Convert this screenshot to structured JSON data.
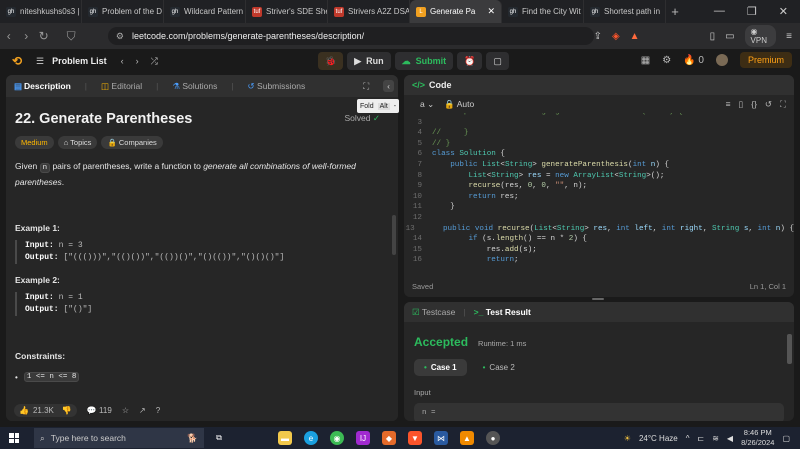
{
  "browser": {
    "tabs": [
      {
        "label": "niteshkushs0s3 |",
        "fav_color": "#24292f",
        "fav_text": "gh"
      },
      {
        "label": "Problem of the D",
        "fav_color": "#24292f",
        "fav_text": "gh"
      },
      {
        "label": "Wildcard Pattern",
        "fav_color": "#24292f",
        "fav_text": "gh"
      },
      {
        "label": "Striver's SDE She",
        "fav_color": "#c0392b",
        "fav_text": "tuf"
      },
      {
        "label": "Strivers A2Z DSA",
        "fav_color": "#c0392b",
        "fav_text": "tuf"
      },
      {
        "label": "Generate Pa",
        "fav_color": "#f0a020",
        "fav_text": "L",
        "active": true
      },
      {
        "label": "Find the City Wit",
        "fav_color": "#24292f",
        "fav_text": "gh"
      },
      {
        "label": "Shortest path in",
        "fav_color": "#24292f",
        "fav_text": "gh"
      }
    ],
    "url": "leetcode.com/problems/generate-parentheses/description/",
    "vpn": "VPN",
    "ext_badge": "1"
  },
  "header": {
    "problem_list": "Problem List",
    "run": "Run",
    "submit": "Submit",
    "fire_count": "0",
    "premium": "Premium"
  },
  "left": {
    "tabs": {
      "description": "Description",
      "editorial": "Editorial",
      "solutions": "Solutions",
      "submissions": "Submissions"
    },
    "title": "22. Generate Parentheses",
    "solved": "Solved",
    "difficulty": "Medium",
    "topics": "Topics",
    "companies": "Companies",
    "desc_pre": "Given ",
    "desc_var": "n",
    "desc_mid": " pairs of parentheses, write a function to ",
    "desc_em": "generate all combinations of well-formed parentheses",
    "desc_end": ".",
    "ex1_title": "Example 1:",
    "ex1_input_label": "Input:",
    "ex1_input": " n = 3",
    "ex1_output_label": "Output:",
    "ex1_output": " [\"((()))\",\"(()())\",\"(())()\",\"()(())\",\"()()()\"]",
    "ex2_title": "Example 2:",
    "ex2_input_label": "Input:",
    "ex2_input": " n = 1",
    "ex2_output_label": "Output:",
    "ex2_output": " [\"()\"]",
    "constraints_title": "Constraints:",
    "constraint": "1 <= n <= 8",
    "likes": "21.3K",
    "comments": "119"
  },
  "fold_tooltip": {
    "label": "Fold",
    "key": "Alt"
  },
  "code": {
    "title": "Code",
    "lang_fragment": "a",
    "auto": "Auto",
    "saved": "Saved",
    "cursor": "Ln 1, Col 1"
  },
  "result": {
    "testcase": "Testcase",
    "test_result": "Test Result",
    "status": "Accepted",
    "runtime": "Runtime: 1 ms",
    "case1": "Case 1",
    "case2": "Case 2",
    "input_label": "Input",
    "input_value": "n ="
  },
  "taskbar": {
    "search": "Type here to search",
    "weather": "24°C  Haze",
    "time": "8:46 PM",
    "date": "8/26/2024"
  }
}
